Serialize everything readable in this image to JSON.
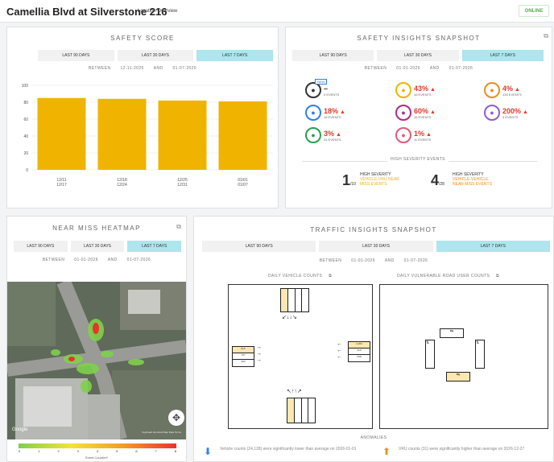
{
  "header": {
    "title": "Camellia Blvd at Silverstone 216",
    "breadcrumb": "Location Overview",
    "status": "ONLINE"
  },
  "colors": {
    "accent": "#aee5ee",
    "bar": "#f0b400",
    "up": "#e0392b",
    "down": "#2f80ed",
    "orange": "#f28c1e"
  },
  "safety": {
    "title": "SAFETY SCORE",
    "tabs": [
      "LAST 90 DAYS",
      "LAST 30 DAYS",
      "LAST 7 DAYS"
    ],
    "active_tab": 2,
    "range": {
      "between": "BETWEEN",
      "from": "12-11-2025",
      "and": "AND",
      "to": "01-07-2026"
    }
  },
  "chart_data": {
    "type": "bar",
    "categories": [
      "12/11 - 12/17",
      "12/18 - 12/24",
      "12/25 - 12/31",
      "01/01 - 01/07"
    ],
    "tick_top": [
      "12/11",
      "12/18",
      "12/25",
      "01/01"
    ],
    "tick_bottom": [
      "12/17",
      "12/24",
      "12/31",
      "01/07"
    ],
    "values": [
      85,
      84,
      82,
      81
    ],
    "ylim": [
      0,
      100
    ],
    "yticks": [
      "0",
      "20",
      "40",
      "60",
      "80",
      "100"
    ],
    "grid": true
  },
  "insights": {
    "title": "SAFETY INSIGHTS SNAPSHOT",
    "tabs": [
      "LAST 90 DAYS",
      "LAST 30 DAYS",
      "LAST 7 DAYS"
    ],
    "active_tab": 2,
    "range": {
      "between": "BETWEEN",
      "from": "01-01-2026",
      "and": "AND",
      "to": "01-07-2026"
    },
    "items": [
      {
        "icon": "car-crash-icon",
        "color": "#333",
        "badge": "NEW",
        "value": "–",
        "events": "0 EVENTS",
        "arrow": ""
      },
      {
        "icon": "car-swerve-icon",
        "color": "#f0b400",
        "value": "43%",
        "events": "16 EVENTS",
        "arrow": "▲"
      },
      {
        "icon": "speeding-icon",
        "color": "#f28c1e",
        "value": "4%",
        "events": "139 EVENTS",
        "arrow": "▲"
      },
      {
        "icon": "pedestrian-icon",
        "color": "#2f80ed",
        "value": "18%",
        "events": "19 EVENTS",
        "arrow": "▲"
      },
      {
        "icon": "no-entry-icon",
        "color": "#b0288a",
        "value": "60%",
        "events": "16 EVENTS",
        "arrow": "▲"
      },
      {
        "icon": "red-light-icon",
        "color": "#8e5cd9",
        "value": "200%",
        "events": "3 EVENTS",
        "arrow": "▲"
      },
      {
        "icon": "wrong-turn-icon",
        "color": "#2e9e4f",
        "value": "3%",
        "events": "31 EVENTS",
        "arrow": "▲"
      },
      {
        "icon": "bicycle-icon",
        "color": "#e05a7a",
        "value": "1%",
        "events": "11 EVENTS",
        "arrow": "▲"
      }
    ],
    "high_sev_label": "HIGH SEVERITY EVENTS",
    "sev1": {
      "num": "1",
      "den": "/10",
      "l1": "HIGH SEVERITY",
      "l2": "VEHICLE-VRU NEAR",
      "l3": "MISS EVENTS"
    },
    "sev2": {
      "num": "4",
      "den": "/28",
      "l1": "HIGH SEVERITY",
      "l2": "VEHICLE-VEHICLE",
      "l3": "NEAR MISS EVENTS"
    }
  },
  "heatmap": {
    "title": "NEAR MISS HEATMAP",
    "tabs": [
      "LAST 90 DAYS",
      "LAST 30 DAYS",
      "LAST 7 DAYS"
    ],
    "active_tab": 2,
    "range": {
      "between": "BETWEEN",
      "from": "01-01-2026",
      "and": "AND",
      "to": "01-07-2026"
    },
    "scale": [
      "0",
      "1",
      "2",
      "3",
      "4",
      "5",
      "6",
      "7",
      "8"
    ],
    "scale_label": "Event Count/m²",
    "attribution": "Keyboard shortcuts  Map Data  Terms",
    "google": "Google"
  },
  "traffic": {
    "title": "TRAFFIC INSIGHTS SNAPSHOT",
    "tabs": [
      "LAST 90 DAYS",
      "LAST 30 DAYS",
      "LAST 7 DAYS"
    ],
    "active_tab": 2,
    "range": {
      "between": "BETWEEN",
      "from": "01-01-2026",
      "and": "AND",
      "to": "01-07-2026"
    },
    "vehicle_label": "DAILY VEHICLE COUNTS",
    "vru_label": "DAILY VULNERABLE ROAD USER COUNTS",
    "west": [
      "815",
      "707",
      "390"
    ],
    "east": [
      "4,203",
      "419",
      "538"
    ],
    "anomalies": "ANOMALIES",
    "anom1": "Vehicle counts (24,128) were significantly lower than average on 2026-01-01",
    "anom2": "VRU counts (31) were significantly higher than average on 2026-12-27"
  }
}
